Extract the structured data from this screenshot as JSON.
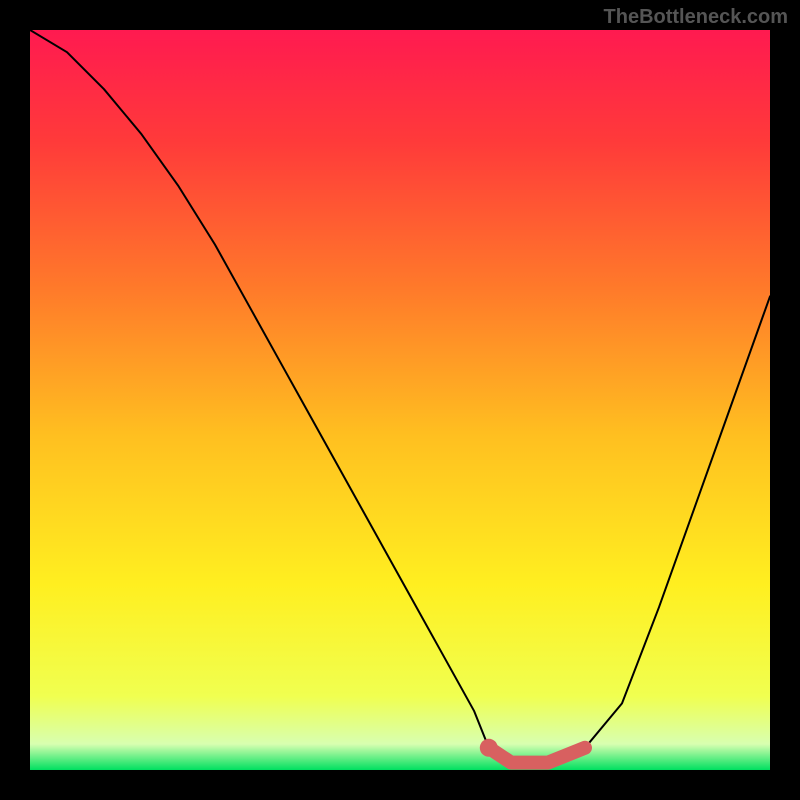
{
  "watermark": "TheBottleneck.com",
  "chart_data": {
    "type": "line",
    "title": "",
    "xlabel": "",
    "ylabel": "",
    "xlim": [
      0,
      100
    ],
    "ylim": [
      0,
      100
    ],
    "series": [
      {
        "name": "bottleneck-curve",
        "x": [
          0,
          5,
          10,
          15,
          20,
          25,
          30,
          35,
          40,
          45,
          50,
          55,
          60,
          62,
          65,
          70,
          75,
          80,
          85,
          90,
          95,
          100
        ],
        "values": [
          100,
          97,
          92,
          86,
          79,
          71,
          62,
          53,
          44,
          35,
          26,
          17,
          8,
          3,
          1,
          1,
          3,
          9,
          22,
          36,
          50,
          64
        ]
      },
      {
        "name": "optimal-range",
        "x": [
          62,
          65,
          70,
          75
        ],
        "values": [
          3,
          1,
          1,
          3
        ]
      }
    ],
    "gradient_stops": [
      {
        "offset": 0.0,
        "color": "#ff1a50"
      },
      {
        "offset": 0.15,
        "color": "#ff3a3a"
      },
      {
        "offset": 0.35,
        "color": "#ff7a2a"
      },
      {
        "offset": 0.55,
        "color": "#ffc020"
      },
      {
        "offset": 0.75,
        "color": "#ffef20"
      },
      {
        "offset": 0.9,
        "color": "#f0ff50"
      },
      {
        "offset": 0.965,
        "color": "#d8ffb0"
      },
      {
        "offset": 1.0,
        "color": "#00e060"
      }
    ],
    "optimal_marker_color": "#d86060"
  }
}
